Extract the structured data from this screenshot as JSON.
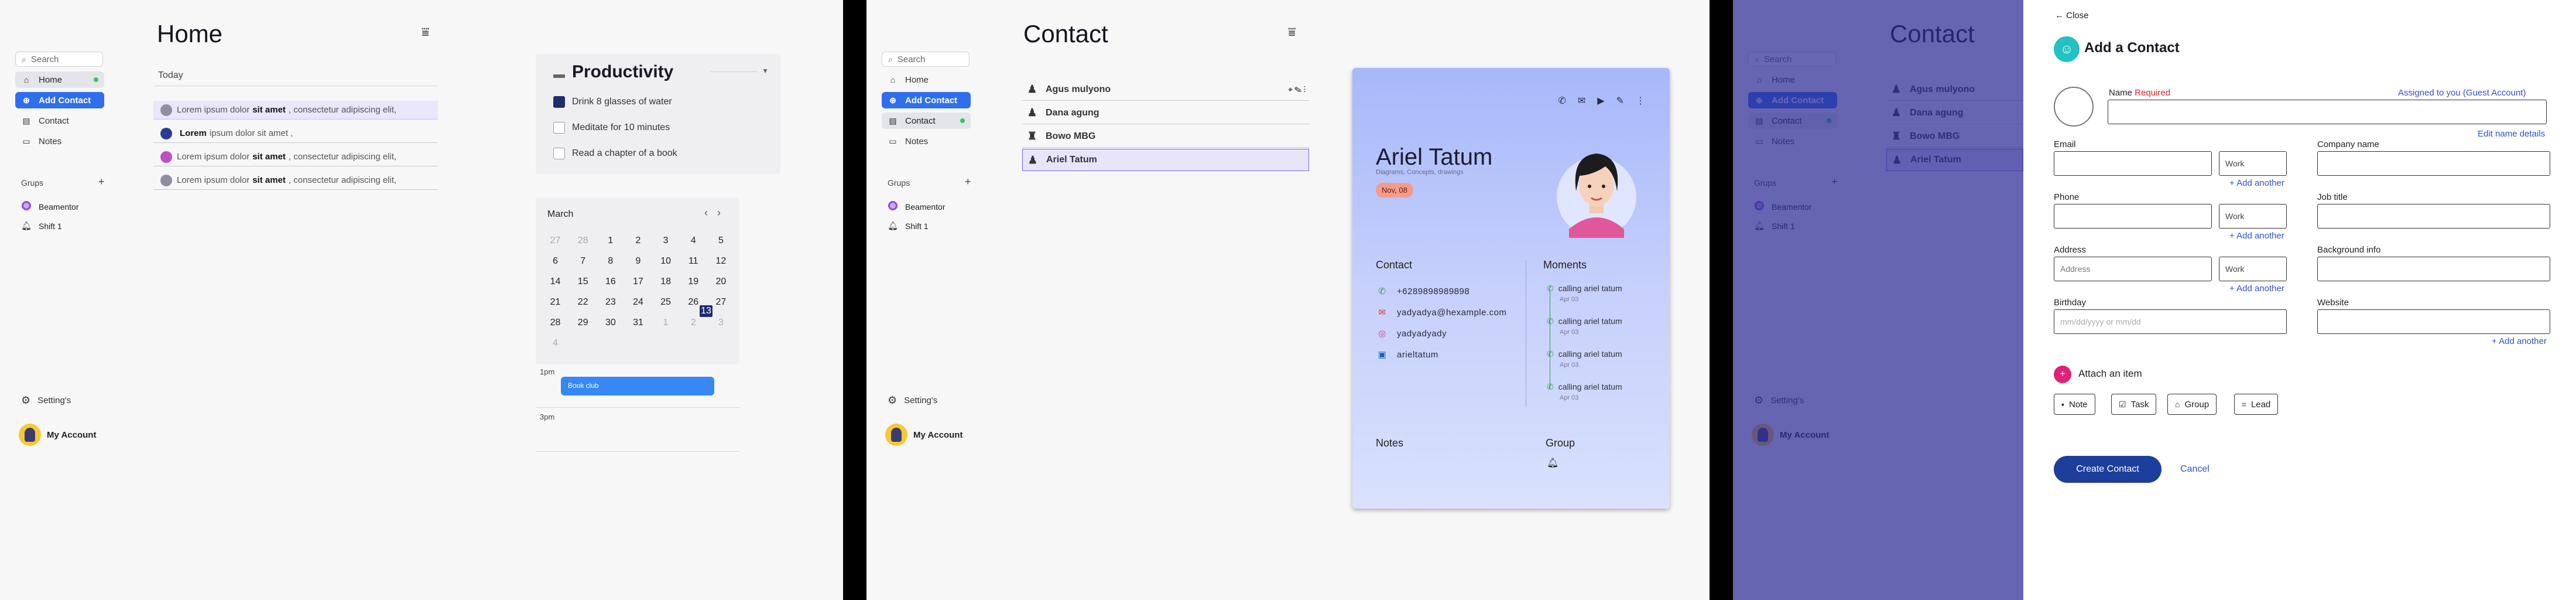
{
  "sidebar": {
    "search": "Search",
    "nav": [
      "Home",
      "Add Contact",
      "Contact",
      "Notes"
    ],
    "groups_header": "Grups",
    "groups": [
      "Beamentor",
      "Shift 1"
    ],
    "settings": "Setting's",
    "account": "My Account"
  },
  "home": {
    "title": "Home",
    "today_label": "Today",
    "notes": [
      {
        "pre": "Lorem ipsum dolor",
        "bold": "sit amet",
        "post": ", consectetur adipiscing elit,",
        "color": "#8f8fa0"
      },
      {
        "pre": "",
        "bold": "Lorem",
        "post": "ipsum dolor sit amet ,",
        "color": "#2b3b8f"
      },
      {
        "pre": "Lorem ipsum dolor",
        "bold": "sit amet",
        "post": ", consectetur adipiscing elit,",
        "color": "#c04fc4"
      },
      {
        "pre": "Lorem ipsum dolor",
        "bold": "sit amet",
        "post": ", consectetur adipiscing elit,",
        "color": "#8f8fa0"
      }
    ],
    "productivity": {
      "title": "Productivity",
      "tasks": [
        {
          "label": "Drink 8 glasses of water",
          "checked": true
        },
        {
          "label": "Meditate for 10 minutes",
          "checked": false
        },
        {
          "label": "Read a chapter of a book",
          "checked": false
        }
      ]
    },
    "calendar": {
      "month": "March",
      "selected_day": "13",
      "days": [
        "27",
        "28",
        "1",
        "2",
        "3",
        "4",
        "5",
        "6",
        "7",
        "8",
        "9",
        "10",
        "11",
        "12",
        "13",
        "14",
        "15",
        "16",
        "17",
        "18",
        "19",
        "20",
        "21",
        "22",
        "23",
        "24",
        "25",
        "26",
        "27",
        "28",
        "29",
        "30",
        "31",
        "1",
        "2",
        "3",
        "4"
      ],
      "muted_indices": [
        0,
        1,
        33,
        34,
        35,
        36
      ]
    },
    "schedule": {
      "time1": "1pm",
      "event": "Book club",
      "time2": "3pm"
    }
  },
  "contact": {
    "title": "Contact",
    "list": [
      "Agus mulyono",
      "Dana agung",
      "Bowo MBG",
      "Ariel Tatum"
    ],
    "selected_index": 3,
    "card": {
      "name": "Ariel Tatum",
      "subtitle": "Diagrams, Concepts, drawings",
      "date": "Nov, 08",
      "contact_header": "Contact",
      "moments_header": "Moments",
      "phone": "+6289898989898",
      "email": "yadyadya@hexample.com",
      "instagram": "yadyadyady",
      "linkedin": "arieltatum",
      "moments": [
        {
          "text": "calling ariel tatum",
          "date": "Apr 03"
        },
        {
          "text": "calling ariel tatum",
          "date": "Apr 03"
        },
        {
          "text": "calling ariel tatum",
          "date": "Apr 03"
        },
        {
          "text": "calling ariel tatum",
          "date": "Apr 03"
        }
      ],
      "notes_header": "Notes",
      "group_header": "Group"
    }
  },
  "add_contact": {
    "close": "Close",
    "title": "Add a Contact",
    "name_label": "Name",
    "required": "Required",
    "assigned": "Assigned to you (Guest Account)",
    "edit_name": "Edit name details",
    "email_label": "Email",
    "phone_label": "Phone",
    "address_label": "Address",
    "address_placeholder": "Address",
    "birthday_label": "Birthday",
    "birthday_placeholder": "mm/dd/yyyy or mm/dd",
    "type_work": "Work",
    "add_another": "+ Add another",
    "company_label": "Company name",
    "job_label": "Job title",
    "background_label": "Background info",
    "website_label": "Website",
    "attach_title": "Attach an item",
    "chips": [
      "Note",
      "Task",
      "Group",
      "Lead"
    ],
    "create": "Create Contact",
    "cancel": "Cancel"
  }
}
